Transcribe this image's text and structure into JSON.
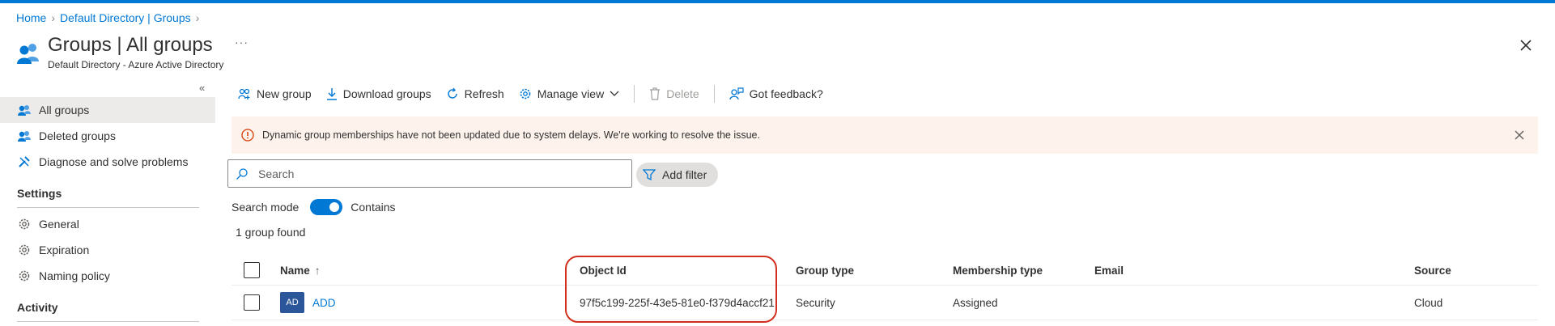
{
  "breadcrumb": {
    "home": "Home",
    "directory": "Default Directory | Groups"
  },
  "header": {
    "title": "Groups | All groups",
    "subtitle": "Default Directory - Azure Active Directory",
    "more": "···"
  },
  "sidebar": {
    "items": [
      {
        "label": "All groups",
        "icon": "groups-icon"
      },
      {
        "label": "Deleted groups",
        "icon": "groups-icon"
      },
      {
        "label": "Diagnose and solve problems",
        "icon": "wrench-icon"
      }
    ],
    "settings_heading": "Settings",
    "settings_items": [
      {
        "label": "General",
        "icon": "gear-icon"
      },
      {
        "label": "Expiration",
        "icon": "gear-icon"
      },
      {
        "label": "Naming policy",
        "icon": "gear-icon"
      }
    ],
    "activity_heading": "Activity"
  },
  "toolbar": {
    "new_group": "New group",
    "download_groups": "Download groups",
    "refresh": "Refresh",
    "manage_view": "Manage view",
    "delete": "Delete",
    "feedback": "Got feedback?"
  },
  "banner": {
    "message": "Dynamic group memberships have not been updated due to system delays. We're working to resolve the issue."
  },
  "search": {
    "placeholder": "Search",
    "add_filter": "Add filter"
  },
  "search_mode": {
    "label": "Search mode",
    "value": "Contains"
  },
  "result_count": "1 group found",
  "table": {
    "columns": {
      "name": "Name",
      "sort_indicator": "↑",
      "object_id": "Object Id",
      "group_type": "Group type",
      "membership_type": "Membership type",
      "email": "Email",
      "source": "Source"
    },
    "rows": [
      {
        "initials": "AD",
        "name": "ADD",
        "object_id": "97f5c199-225f-43e5-81e0-f379d4accf21",
        "group_type": "Security",
        "membership_type": "Assigned",
        "email": "",
        "source": "Cloud"
      }
    ]
  },
  "colors": {
    "accent": "#0078d4",
    "highlight": "#d32f1e",
    "banner_bg": "#fdf3ec",
    "avatar": "#2b579a"
  }
}
